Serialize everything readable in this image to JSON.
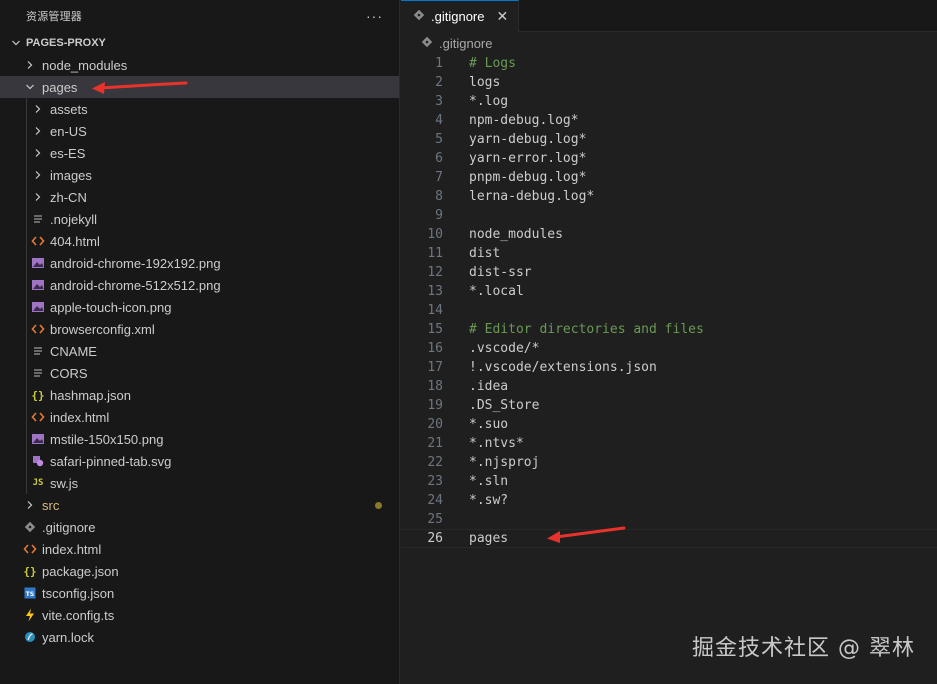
{
  "sidebar": {
    "title": "资源管理器",
    "more_label": "···",
    "project": "PAGES-PROXY",
    "items": [
      {
        "label": "node_modules",
        "kind": "folder",
        "expanded": false,
        "depth": 0,
        "icon": "chevron-right-icon"
      },
      {
        "label": "pages",
        "kind": "folder",
        "expanded": true,
        "depth": 0,
        "selected": true,
        "icon": "chevron-down-icon"
      },
      {
        "label": "assets",
        "kind": "folder",
        "expanded": false,
        "depth": 1,
        "icon": "chevron-right-icon"
      },
      {
        "label": "en-US",
        "kind": "folder",
        "expanded": false,
        "depth": 1,
        "icon": "chevron-right-icon"
      },
      {
        "label": "es-ES",
        "kind": "folder",
        "expanded": false,
        "depth": 1,
        "icon": "chevron-right-icon"
      },
      {
        "label": "images",
        "kind": "folder",
        "expanded": false,
        "depth": 1,
        "icon": "chevron-right-icon"
      },
      {
        "label": "zh-CN",
        "kind": "folder",
        "expanded": false,
        "depth": 1,
        "icon": "chevron-right-icon"
      },
      {
        "label": ".nojekyll",
        "kind": "file",
        "depth": 1,
        "icon": "text-file-icon"
      },
      {
        "label": "404.html",
        "kind": "file",
        "depth": 1,
        "icon": "html-file-icon"
      },
      {
        "label": "android-chrome-192x192.png",
        "kind": "file",
        "depth": 1,
        "icon": "image-file-icon"
      },
      {
        "label": "android-chrome-512x512.png",
        "kind": "file",
        "depth": 1,
        "icon": "image-file-icon"
      },
      {
        "label": "apple-touch-icon.png",
        "kind": "file",
        "depth": 1,
        "icon": "image-file-icon"
      },
      {
        "label": "browserconfig.xml",
        "kind": "file",
        "depth": 1,
        "icon": "xml-file-icon"
      },
      {
        "label": "CNAME",
        "kind": "file",
        "depth": 1,
        "icon": "text-file-icon"
      },
      {
        "label": "CORS",
        "kind": "file",
        "depth": 1,
        "icon": "text-file-icon"
      },
      {
        "label": "hashmap.json",
        "kind": "file",
        "depth": 1,
        "icon": "json-file-icon"
      },
      {
        "label": "index.html",
        "kind": "file",
        "depth": 1,
        "icon": "html-file-icon"
      },
      {
        "label": "mstile-150x150.png",
        "kind": "file",
        "depth": 1,
        "icon": "image-file-icon"
      },
      {
        "label": "safari-pinned-tab.svg",
        "kind": "file",
        "depth": 1,
        "icon": "svg-file-icon"
      },
      {
        "label": "sw.js",
        "kind": "file",
        "depth": 1,
        "icon": "js-file-icon"
      },
      {
        "label": "src",
        "kind": "folder",
        "expanded": false,
        "depth": 0,
        "modified": true,
        "icon": "chevron-right-icon"
      },
      {
        "label": ".gitignore",
        "kind": "file",
        "depth": 0,
        "icon": "git-file-icon"
      },
      {
        "label": "index.html",
        "kind": "file",
        "depth": 0,
        "icon": "html-file-icon"
      },
      {
        "label": "package.json",
        "kind": "file",
        "depth": 0,
        "icon": "json-file-icon"
      },
      {
        "label": "tsconfig.json",
        "kind": "file",
        "depth": 0,
        "icon": "ts-file-icon"
      },
      {
        "label": "vite.config.ts",
        "kind": "file",
        "depth": 0,
        "icon": "vite-file-icon"
      },
      {
        "label": "yarn.lock",
        "kind": "file",
        "depth": 0,
        "icon": "yarn-file-icon"
      }
    ]
  },
  "editor": {
    "tab_label": ".gitignore",
    "tab_close": "✕",
    "breadcrumb": ".gitignore",
    "active_line": 26,
    "lines": [
      "# Logs",
      "logs",
      "*.log",
      "npm-debug.log*",
      "yarn-debug.log*",
      "yarn-error.log*",
      "pnpm-debug.log*",
      "lerna-debug.log*",
      "",
      "node_modules",
      "dist",
      "dist-ssr",
      "*.local",
      "",
      "# Editor directories and files",
      ".vscode/*",
      "!.vscode/extensions.json",
      ".idea",
      ".DS_Store",
      "*.suo",
      "*.ntvs*",
      "*.njsproj",
      "*.sln",
      "*.sw?",
      "",
      "pages"
    ]
  },
  "watermark": "掘金技术社区 @ 翠林",
  "colors": {
    "accent": "#0078d4",
    "arrow": "#e8322c",
    "comment": "#6a9955",
    "modified_dot": "#8a7a28"
  }
}
